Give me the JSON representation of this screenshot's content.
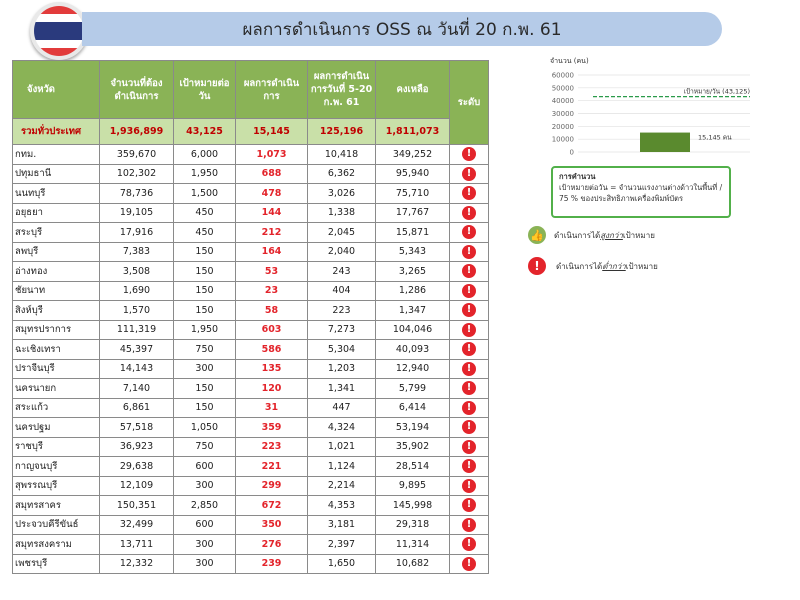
{
  "title": "ผลการดำเนินการ OSS ณ วันที่ 20 ก.พ. 61",
  "table": {
    "headers": [
      "จังหวัด",
      "จำนวนที่ต้องดำเนินการ",
      "เป้าหมายต่อวัน",
      "ผลการดำเนินการ",
      "ผลการดำเนินการวันที่ 5-20 ก.พ. 61",
      "คงเหลือ",
      "ระดับ"
    ],
    "total": {
      "province": "รวมทั่วประเทศ",
      "required": "1,936,899",
      "target": "43,125",
      "result": "15,145",
      "period": "125,196",
      "remaining": "1,811,073"
    },
    "rows": [
      {
        "province": "กทม.",
        "required": "359,670",
        "target": "6,000",
        "result": "1,073",
        "period": "10,418",
        "remaining": "349,252"
      },
      {
        "province": "ปทุมธานี",
        "required": "102,302",
        "target": "1,950",
        "result": "688",
        "period": "6,362",
        "remaining": "95,940"
      },
      {
        "province": "นนทบุรี",
        "required": "78,736",
        "target": "1,500",
        "result": "478",
        "period": "3,026",
        "remaining": "75,710"
      },
      {
        "province": "อยุธยา",
        "required": "19,105",
        "target": "450",
        "result": "144",
        "period": "1,338",
        "remaining": "17,767"
      },
      {
        "province": "สระบุรี",
        "required": "17,916",
        "target": "450",
        "result": "212",
        "period": "2,045",
        "remaining": "15,871"
      },
      {
        "province": "ลพบุรี",
        "required": "7,383",
        "target": "150",
        "result": "164",
        "period": "2,040",
        "remaining": "5,343"
      },
      {
        "province": "อ่างทอง",
        "required": "3,508",
        "target": "150",
        "result": "53",
        "period": "243",
        "remaining": "3,265"
      },
      {
        "province": "ชัยนาท",
        "required": "1,690",
        "target": "150",
        "result": "23",
        "period": "404",
        "remaining": "1,286"
      },
      {
        "province": "สิงห์บุรี",
        "required": "1,570",
        "target": "150",
        "result": "58",
        "period": "223",
        "remaining": "1,347"
      },
      {
        "province": "สมุทรปราการ",
        "required": "111,319",
        "target": "1,950",
        "result": "603",
        "period": "7,273",
        "remaining": "104,046"
      },
      {
        "province": "ฉะเชิงเทรา",
        "required": "45,397",
        "target": "750",
        "result": "586",
        "period": "5,304",
        "remaining": "40,093"
      },
      {
        "province": "ปราจีนบุรี",
        "required": "14,143",
        "target": "300",
        "result": "135",
        "period": "1,203",
        "remaining": "12,940"
      },
      {
        "province": "นครนายก",
        "required": "7,140",
        "target": "150",
        "result": "120",
        "period": "1,341",
        "remaining": "5,799"
      },
      {
        "province": "สระแก้ว",
        "required": "6,861",
        "target": "150",
        "result": "31",
        "period": "447",
        "remaining": "6,414"
      },
      {
        "province": "นครปฐม",
        "required": "57,518",
        "target": "1,050",
        "result": "359",
        "period": "4,324",
        "remaining": "53,194"
      },
      {
        "province": "ราชบุรี",
        "required": "36,923",
        "target": "750",
        "result": "223",
        "period": "1,021",
        "remaining": "35,902"
      },
      {
        "province": "กาญจนบุรี",
        "required": "29,638",
        "target": "600",
        "result": "221",
        "period": "1,124",
        "remaining": "28,514"
      },
      {
        "province": "สุพรรณบุรี",
        "required": "12,109",
        "target": "300",
        "result": "299",
        "period": "2,214",
        "remaining": "9,895"
      },
      {
        "province": "สมุทรสาคร",
        "required": "150,351",
        "target": "2,850",
        "result": "672",
        "period": "4,353",
        "remaining": "145,998"
      },
      {
        "province": "ประจวบคีรีขันธ์",
        "required": "32,499",
        "target": "600",
        "result": "350",
        "period": "3,181",
        "remaining": "29,318"
      },
      {
        "province": "สมุทรสงคราม",
        "required": "13,711",
        "target": "300",
        "result": "276",
        "period": "2,397",
        "remaining": "11,314"
      },
      {
        "province": "เพชรบุรี",
        "required": "12,332",
        "target": "300",
        "result": "239",
        "period": "1,650",
        "remaining": "10,682"
      }
    ]
  },
  "chart_data": {
    "type": "bar",
    "ylabel": "จำนวน (คน)",
    "ylim": [
      0,
      60000
    ],
    "yticks": [
      "60000",
      "50000",
      "40000",
      "30000",
      "20000",
      "10000",
      "0"
    ],
    "values": [
      15145
    ],
    "bar_label": "15,145 คน",
    "target_value": 43125,
    "target_label": "เป้าหมาย/วัน (43,125)",
    "bar_color": "#5a8a2e",
    "target_color": "#2a9a4a"
  },
  "calc_box": {
    "title": "การคำนวน",
    "line1": "เป้าหมายต่อวัน = จำนวนแรงงานต่างด้าวในพื้นที่ /",
    "line2": "75 % ของประสิทธิภาพเครื่องพิมพ์บัตร"
  },
  "legend": {
    "above_prefix": "ดำเนินการได้",
    "above_em": "สูงกว่า",
    "above_suffix": "เป้าหมาย",
    "below_prefix": "ดำเนินการได้",
    "below_em": "ต่ำกว่า",
    "below_suffix": "เป้าหมาย",
    "alert_glyph": "!",
    "thumb_glyph": "👍"
  },
  "colors": {
    "header_green": "#8ab356",
    "total_green": "#c9e0a8",
    "alert_red": "#e3242b",
    "title_blue": "#b5cbe8"
  }
}
